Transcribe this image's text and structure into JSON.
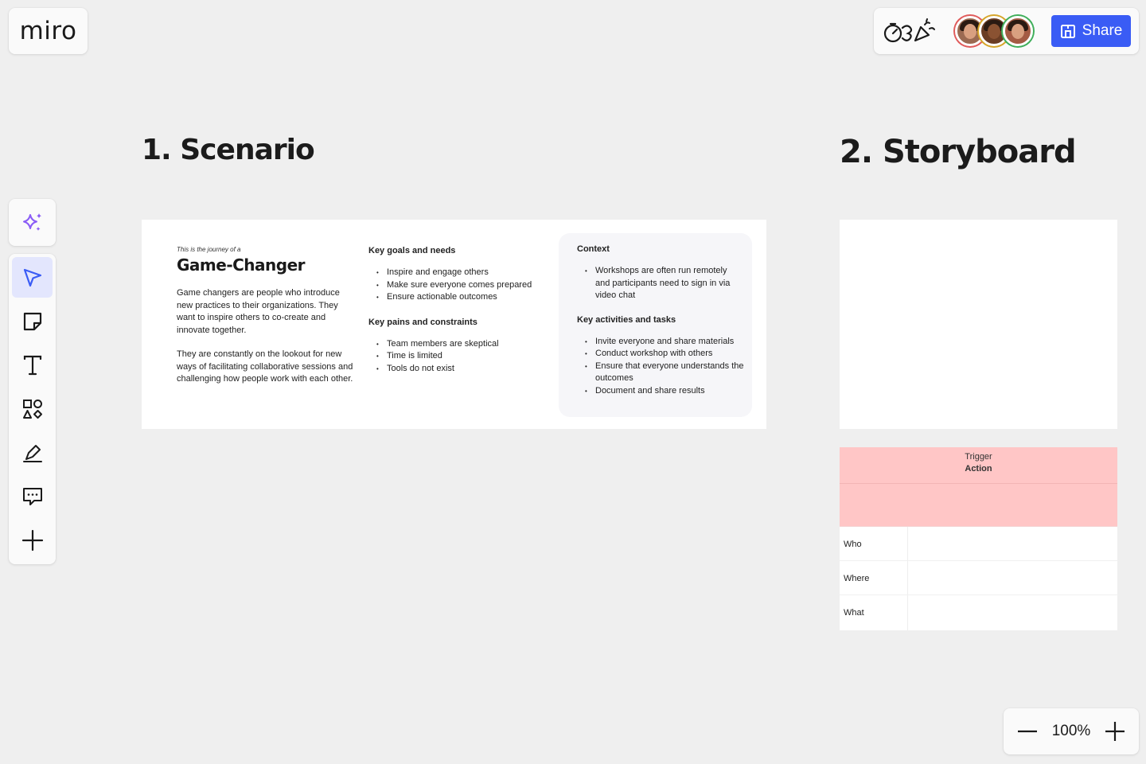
{
  "logo": {
    "text": "miro"
  },
  "topbar": {
    "timer_icon": "timer-icon",
    "celebrate_icon": "party-popper-icon",
    "share_label": "Share",
    "share_icon": "board-share-icon",
    "accent_color": "#3a5cf5"
  },
  "toolbar": {
    "ai_icon": "sparkle-icon",
    "tools": [
      {
        "name": "select",
        "icon": "cursor-arrow-icon",
        "active": true
      },
      {
        "name": "sticky-note",
        "icon": "sticky-note-icon"
      },
      {
        "name": "text",
        "icon": "text-icon"
      },
      {
        "name": "shapes",
        "icon": "shapes-icon"
      },
      {
        "name": "pen",
        "icon": "pen-icon"
      },
      {
        "name": "comment",
        "icon": "comment-icon"
      },
      {
        "name": "more",
        "icon": "plus-icon"
      }
    ]
  },
  "sections": {
    "scenario_title": "1. Scenario",
    "storyboard_title": "2. Storyboard"
  },
  "scenario": {
    "journey_label": "This is the journey of a",
    "persona": "Game-Changer",
    "desc1": "Game changers are people who introduce new practices to their organizations. They want to inspire others to co-create and innovate together.",
    "desc2": "They are constantly on the lookout for new ways of facilitating collaborative sessions and challenging how people work with each other.",
    "goals_heading": "Key goals and needs",
    "goals": [
      "Inspire and engage others",
      "Make sure everyone comes prepared",
      "Ensure actionable outcomes"
    ],
    "pains_heading": "Key pains and constraints",
    "pains": [
      "Team members are skeptical",
      "Time is limited",
      "Tools do not exist"
    ],
    "context_heading": "Context",
    "context": [
      "Workshops are often run remotely and participants need to sign in via video chat"
    ],
    "activities_heading": "Key activities and tasks",
    "activities": [
      "Invite everyone and share materials",
      "Conduct workshop with others",
      "Ensure that everyone understands the outcomes",
      "Document and share results"
    ]
  },
  "storyboard": {
    "trigger_label": "Trigger",
    "action_label": "Action",
    "header_color": "#ffc6c6",
    "rows": [
      "Who",
      "Where",
      "What"
    ]
  },
  "zoom": {
    "level": "100%",
    "minus_icon": "zoom-out-icon",
    "plus_icon": "zoom-in-icon"
  }
}
